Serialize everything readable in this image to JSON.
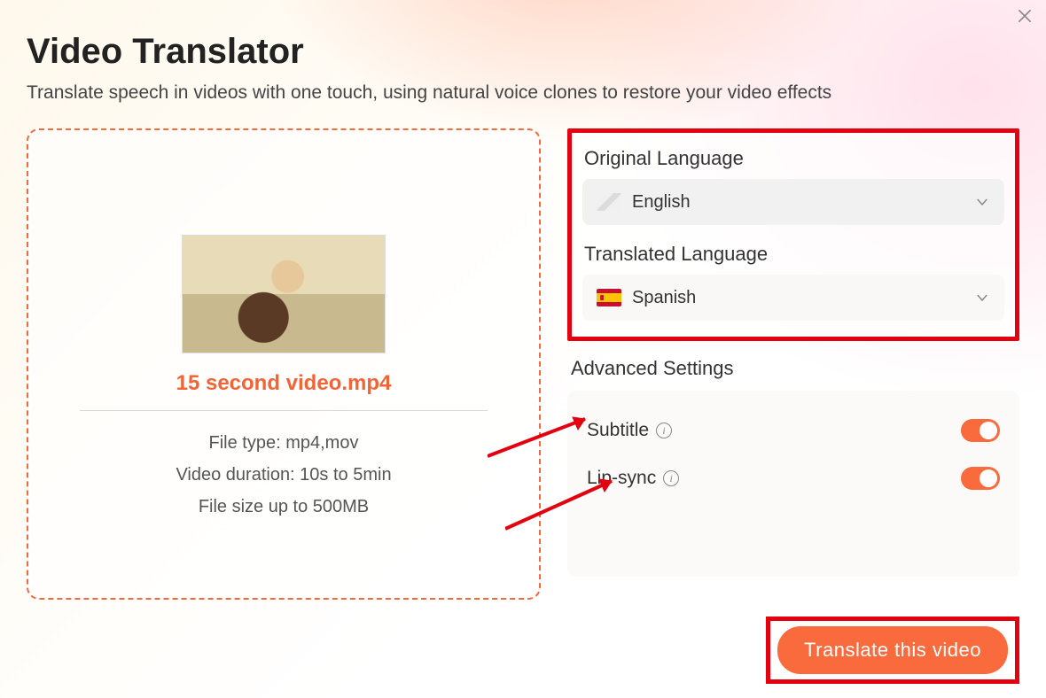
{
  "header": {
    "title": "Video Translator",
    "subtitle": "Translate speech in videos with one touch, using natural voice clones to restore your video effects"
  },
  "upload": {
    "filename": "15 second video.mp4",
    "spec_filetype": "File type: mp4,mov",
    "spec_duration": "Video duration: 10s to 5min",
    "spec_size": "File size up to  500MB"
  },
  "languages": {
    "original_label": "Original Language",
    "original_value": "English",
    "translated_label": "Translated Language",
    "translated_value": "Spanish"
  },
  "advanced": {
    "section_label": "Advanced Settings",
    "subtitle_label": "Subtitle",
    "subtitle_on": true,
    "lipsync_label": "Lip-sync",
    "lipsync_on": true
  },
  "cta": {
    "label": "Translate this video"
  }
}
